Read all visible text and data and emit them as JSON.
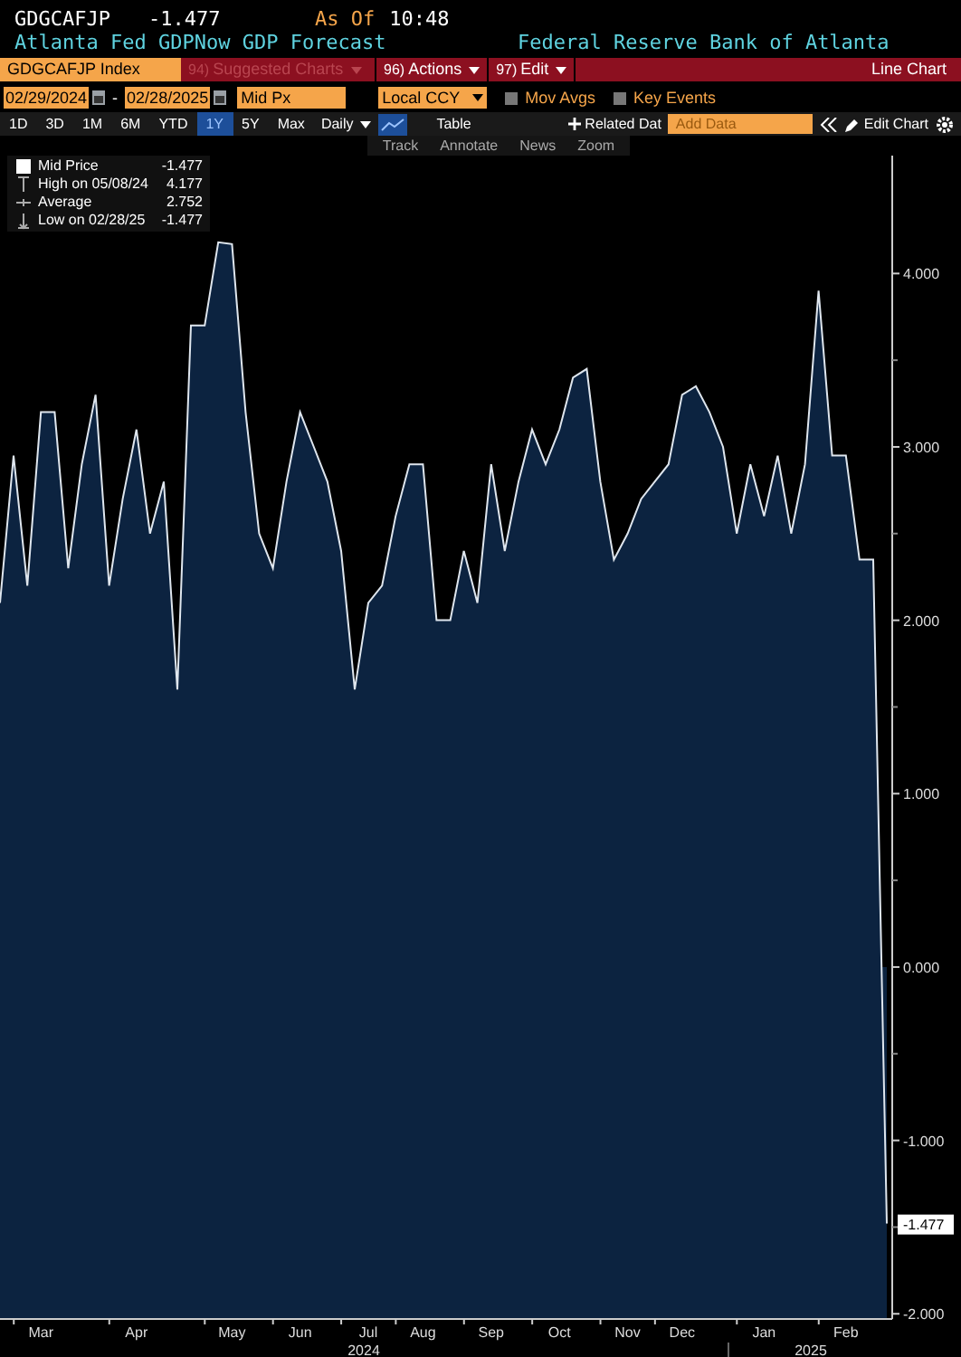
{
  "header": {
    "ticker": "GDGCAFJP",
    "last": "-1.477",
    "as_of_label": "As Of",
    "time": "10:48",
    "title": "Atlanta Fed GDPNow GDP Forecast",
    "source": "Federal Reserve Bank of Atlanta"
  },
  "command_bar": {
    "security": "GDGCAFJP Index",
    "menus": [
      {
        "number": "94)",
        "label": "Suggested Charts",
        "disabled": true
      },
      {
        "number": "96)",
        "label": "Actions",
        "disabled": false
      },
      {
        "number": "97)",
        "label": "Edit",
        "disabled": false
      }
    ],
    "chart_type": "Line Chart"
  },
  "settings": {
    "start_date": "02/29/2024",
    "separator": "-",
    "end_date": "02/28/2025",
    "field": "Mid Px",
    "currency": "Local CCY",
    "options": [
      {
        "label": "Mov Avgs",
        "checked": false
      },
      {
        "label": "Key Events",
        "checked": false
      }
    ]
  },
  "periods": [
    {
      "label": "1D",
      "selected": false
    },
    {
      "label": "3D",
      "selected": false
    },
    {
      "label": "1M",
      "selected": false
    },
    {
      "label": "6M",
      "selected": false
    },
    {
      "label": "YTD",
      "selected": false
    },
    {
      "label": "1Y",
      "selected": true
    },
    {
      "label": "5Y",
      "selected": false
    },
    {
      "label": "Max",
      "selected": false
    }
  ],
  "frequency": "Daily",
  "table_button": "Table",
  "year_labels": [
    "2024",
    "2025"
  ],
  "related": "Related Dat",
  "add_data_placeholder": "Add Data",
  "edit_chart": "Edit Chart",
  "tools": [
    "Track",
    "Annotate",
    "News",
    "Zoom"
  ],
  "legend": [
    {
      "kind": "last",
      "value": "-1.477"
    },
    {
      "kind": "high",
      "label": "High on 05/08/24",
      "value": "4.177"
    },
    {
      "kind": "average",
      "label": "Average",
      "value": "2.752"
    },
    {
      "kind": "low",
      "label": "Low on 02/28/25",
      "value": "-1.477"
    }
  ],
  "chart_data": {
    "type": "area",
    "categories": [
      null,
      null,
      null,
      "Mar",
      null,
      null,
      null,
      null,
      null,
      null,
      "Apr",
      null,
      null,
      null,
      null,
      null,
      null,
      "May",
      null,
      null,
      null,
      null,
      "Jun",
      null,
      null,
      null,
      null,
      "Jul",
      null,
      null,
      null,
      "Aug",
      null,
      null,
      null,
      null,
      "Sep",
      null,
      null,
      null,
      null,
      "Oct",
      null,
      null,
      null,
      null,
      "Nov",
      null,
      null,
      null,
      "Dec",
      null,
      null,
      null,
      null,
      null,
      "Jan",
      null,
      null,
      null,
      null,
      null,
      "Feb",
      null,
      null,
      null
    ],
    "series": [
      {
        "name": "Mid Price",
        "color": "#dfe6ee",
        "values": [
          2.1,
          2.95,
          2.2,
          3.2,
          3.2,
          2.3,
          2.9,
          3.3,
          2.2,
          2.7,
          3.1,
          2.5,
          2.8,
          1.6,
          3.7,
          3.7,
          4.18,
          4.17,
          3.2,
          2.5,
          2.3,
          2.8,
          3.2,
          3.0,
          2.8,
          2.4,
          1.6,
          2.1,
          2.2,
          2.6,
          2.9,
          2.9,
          2.0,
          2.0,
          2.4,
          2.1,
          2.9,
          2.4,
          2.8,
          3.1,
          2.9,
          3.1,
          3.4,
          3.45,
          2.8,
          2.35,
          2.5,
          2.7,
          2.8,
          2.9,
          3.3,
          3.35,
          3.2,
          3.0,
          2.5,
          2.9,
          2.6,
          2.95,
          2.5,
          2.9,
          3.9,
          2.95,
          2.95,
          2.35,
          2.35,
          -1.48
        ]
      }
    ],
    "yticks": [
      {
        "value": 4,
        "label": "4.000"
      },
      {
        "value": 3,
        "label": "3.000"
      },
      {
        "value": 2,
        "label": "2.000"
      },
      {
        "value": 1,
        "label": "1.000"
      },
      {
        "value": 0,
        "label": "0.000"
      },
      {
        "value": -1,
        "label": "-1.000"
      },
      {
        "value": -2,
        "label": "-2.000"
      }
    ],
    "ylim": [
      -2.03,
      4.68
    ],
    "bands": [
      {
        "axis": "y",
        "from": -2.03,
        "to": 0,
        "color": "#0c2340"
      }
    ],
    "annotations": [
      "-1.477"
    ]
  }
}
